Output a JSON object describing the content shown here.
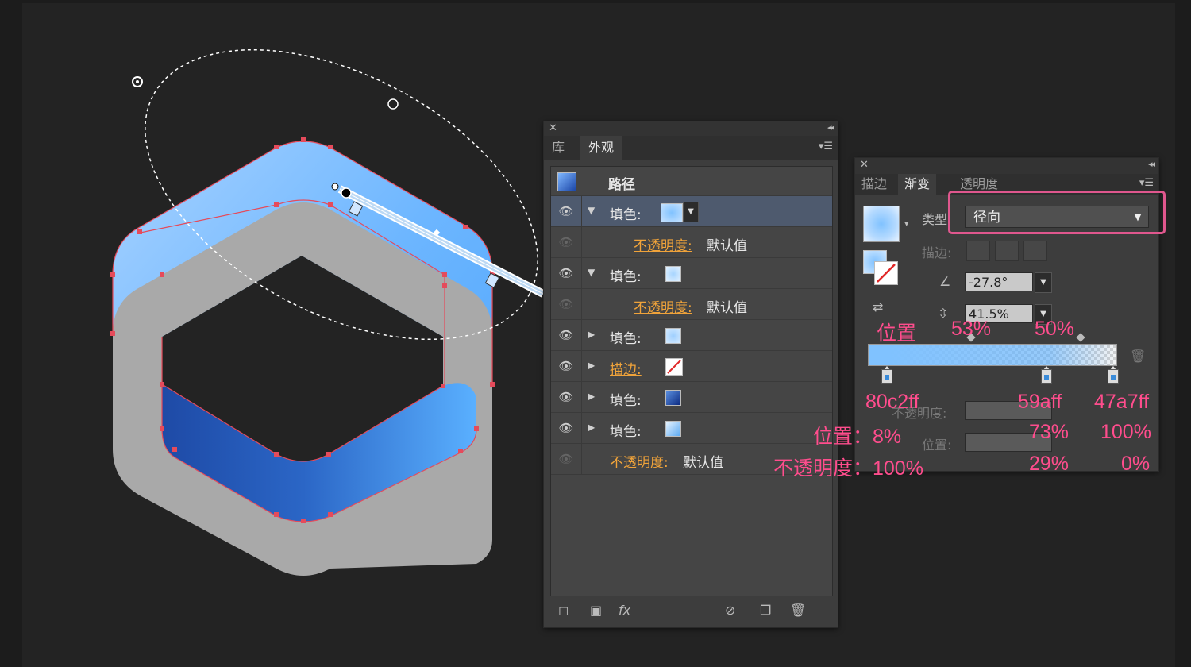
{
  "appearance_panel": {
    "tabs": [
      {
        "label": "库"
      },
      {
        "label": "外观"
      }
    ],
    "path_label": "路径",
    "rows": [
      {
        "label": "填色:",
        "type": "fill",
        "expanded": true,
        "selected": true
      },
      {
        "label": "不透明度:",
        "value": "默认值",
        "type": "opacity"
      },
      {
        "label": "填色:",
        "type": "fill",
        "expanded": true
      },
      {
        "label": "不透明度:",
        "value": "默认值",
        "type": "opacity"
      },
      {
        "label": "填色:",
        "type": "fill"
      },
      {
        "label": "描边:",
        "type": "stroke"
      },
      {
        "label": "填色:",
        "type": "fill"
      },
      {
        "label": "填色:",
        "type": "fill"
      },
      {
        "label": "不透明度:",
        "value": "默认值",
        "type": "opacity"
      }
    ]
  },
  "gradient_panel": {
    "tabs": [
      {
        "label": "描边"
      },
      {
        "label": "渐变"
      },
      {
        "label": "透明度"
      }
    ],
    "type_label": "类型:",
    "type_value": "径向",
    "stroke_label": "描边:",
    "angle_value": "-27.8°",
    "aspect_value": "41.5%",
    "opacity_label": "不透明度:",
    "position_label": "位置:",
    "stops": [
      {
        "position": 8,
        "color": "#80c2ff"
      },
      {
        "position": 73,
        "color": "#59afff"
      },
      {
        "position": 100,
        "color": "#47a7ff"
      }
    ]
  },
  "annotations": {
    "pos_header": "位置",
    "mid1": "53%",
    "mid2": "50%",
    "c1": "80c2ff",
    "c2": "59aff",
    "c3": "47a7ff",
    "pos_row": "位置：8%",
    "p2": "73%",
    "p3": "100%",
    "op_row": "不透明度：100%",
    "o2": "29%",
    "o3": "0%"
  },
  "colors": {
    "accent_pink": "#ff4d8d",
    "anchor_red": "#e54b5b",
    "hex_gray": "#a9a9a9"
  }
}
